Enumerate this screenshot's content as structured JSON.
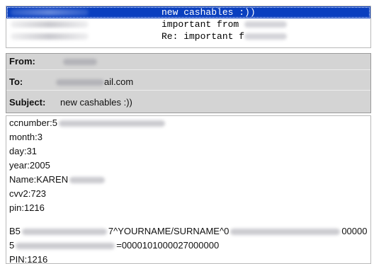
{
  "message_list": [
    {
      "subject": "new cashables :))",
      "selected": true
    },
    {
      "subject": "important from ",
      "selected": false
    },
    {
      "subject": "Re: important f",
      "selected": false
    }
  ],
  "headers": {
    "from_label": "From:",
    "to_label": "To:",
    "to_value_suffix": "ail.com",
    "subject_label": "Subject:",
    "subject_value": "new cashables :))"
  },
  "body": {
    "ccnumber": "ccnumber:5",
    "month": "month:3",
    "day": "day:31",
    "year": "year:2005",
    "name": "Name:KAREN",
    "cvv2": "cvv2:723",
    "pin": "pin:1216",
    "track1_start": "B5",
    "track1_mid": "7^YOURNAME/SURNAME^0",
    "track1_end": "00000",
    "track2_start": "5",
    "track2_end": "=0000101000027000000",
    "pin2": "PIN:1216"
  },
  "colors": {
    "selection": "#0a3fbf",
    "header_bg": "#d4d4d4"
  }
}
